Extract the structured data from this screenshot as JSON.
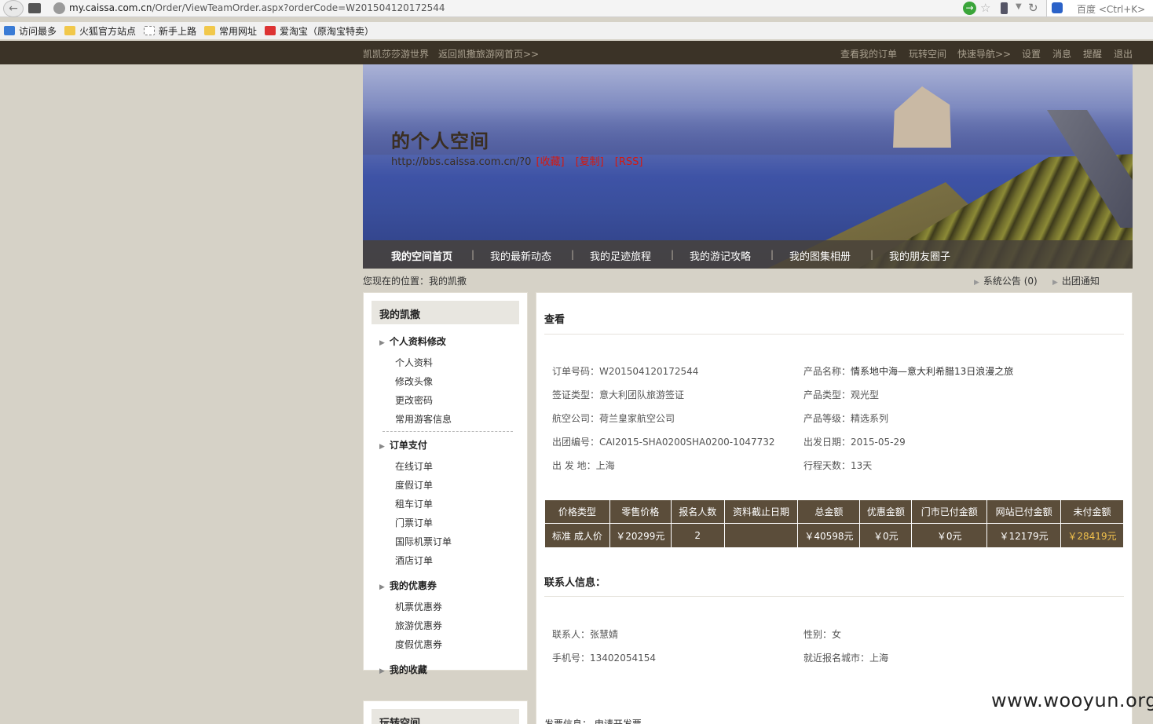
{
  "browser": {
    "url_prefix": "my.caissa.com.cn",
    "url_rest": "/Order/ViewTeamOrder.aspx?orderCode=W201504120172544",
    "search_placeholder": "百度 <Ctrl+K>",
    "back_glyph": "←",
    "go_glyph": "→",
    "star_glyph": "☆",
    "dropdown_glyph": "▼",
    "reload_glyph": "↻"
  },
  "bookmarks": [
    {
      "label": "访问最多",
      "icon": "blue"
    },
    {
      "label": "火狐官方站点",
      "icon": "folder"
    },
    {
      "label": "新手上路",
      "icon": "dot"
    },
    {
      "label": "常用网址",
      "icon": "folder"
    },
    {
      "label": "爱淘宝（原淘宝特卖）",
      "icon": "red"
    }
  ],
  "topbar": {
    "left": [
      "凯凯莎莎游世界",
      "返回凯撒旅游网首页>>"
    ],
    "right": [
      "查看我的订单",
      "玩转空间",
      "快速导航>>",
      "设置",
      "消息",
      "提醒",
      "退出"
    ]
  },
  "banner": {
    "title": "的个人空间",
    "url": "http://bbs.caissa.com.cn/?0",
    "links": [
      "[收藏]",
      "[复制]",
      "[RSS]"
    ]
  },
  "spacenav": [
    "我的空间首页",
    "我的最新动态",
    "我的足迹旅程",
    "我的游记攻略",
    "我的图集相册",
    "我的朋友圈子"
  ],
  "spacenav_sep": "|",
  "breadcrumb": "您现在的位置：我的凯撒",
  "notices": [
    "系统公告 (0)",
    "出团通知"
  ],
  "notice_arrow": "▶",
  "sidebar": {
    "title": "我的凯撒",
    "sections": [
      {
        "label": "个人资料修改",
        "items": [
          "个人资料",
          "修改头像",
          "更改密码",
          "常用游客信息"
        ]
      },
      {
        "label": "订单支付",
        "items": [
          "在线订单",
          "度假订单",
          "租车订单",
          "门票订单",
          "国际机票订单",
          "酒店订单"
        ]
      },
      {
        "label": "我的优惠券",
        "items": [
          "机票优惠券",
          "旅游优惠券",
          "度假优惠券"
        ]
      },
      {
        "label": "我的收藏",
        "items": []
      }
    ],
    "title2": "玩转空间"
  },
  "main": {
    "heading": "查看",
    "order": {
      "left": [
        {
          "k": "订单号码：",
          "v": "W201504120172544"
        },
        {
          "k": "签证类型：",
          "v": "意大利团队旅游签证"
        },
        {
          "k": "航空公司：",
          "v": "荷兰皇家航空公司"
        },
        {
          "k": "出团编号：",
          "v": "CAI2015-SHA0200SHA0200-1047732"
        },
        {
          "k": "出 发 地：",
          "v": "上海"
        }
      ],
      "right": [
        {
          "k": "产品名称：",
          "v": "情系地中海—意大利希腊13日浪漫之旅"
        },
        {
          "k": "产品类型：",
          "v": "观光型"
        },
        {
          "k": "产品等级：",
          "v": "精选系列"
        },
        {
          "k": "出发日期：",
          "v": "2015-05-29"
        },
        {
          "k": "行程天数：",
          "v": "13天"
        }
      ]
    },
    "price_table": {
      "headers": [
        "价格类型",
        "零售价格",
        "报名人数",
        "资料截止日期",
        "总金额",
        "优惠金额",
        "门市已付金额",
        "网站已付金额",
        "未付金额"
      ],
      "row": [
        "标准 成人价",
        "￥20299元",
        "2",
        "",
        "￥40598元",
        "￥0元",
        "￥0元",
        "￥12179元",
        "￥28419元"
      ]
    },
    "contact_heading": "联系人信息：",
    "contact": {
      "left": [
        {
          "k": "联系人：",
          "v": "张慧婧"
        },
        {
          "k": "手机号：",
          "v": "13402054154"
        }
      ],
      "right": [
        {
          "k": "性别：",
          "v": "女"
        },
        {
          "k": "就近报名城市：",
          "v": "上海"
        }
      ]
    },
    "invoice_partial": "发票信息：  申请开发票"
  },
  "watermark": "www.wooyun.org"
}
